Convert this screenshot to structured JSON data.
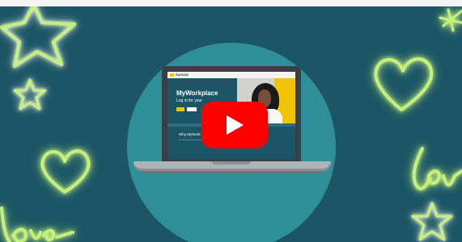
{
  "video": {
    "play_button": "play-icon"
  },
  "laptop_screen": {
    "logo_text": "SAVVAS",
    "title": "MyWorkplace",
    "subtitle": "Log in for your",
    "section_heading": "Why MyWork"
  },
  "colors": {
    "background": "#1b5566",
    "circle": "#2f8f98",
    "neon": "#c4f07a",
    "play": "#ff0000",
    "accent_yellow": "#f2c300"
  }
}
